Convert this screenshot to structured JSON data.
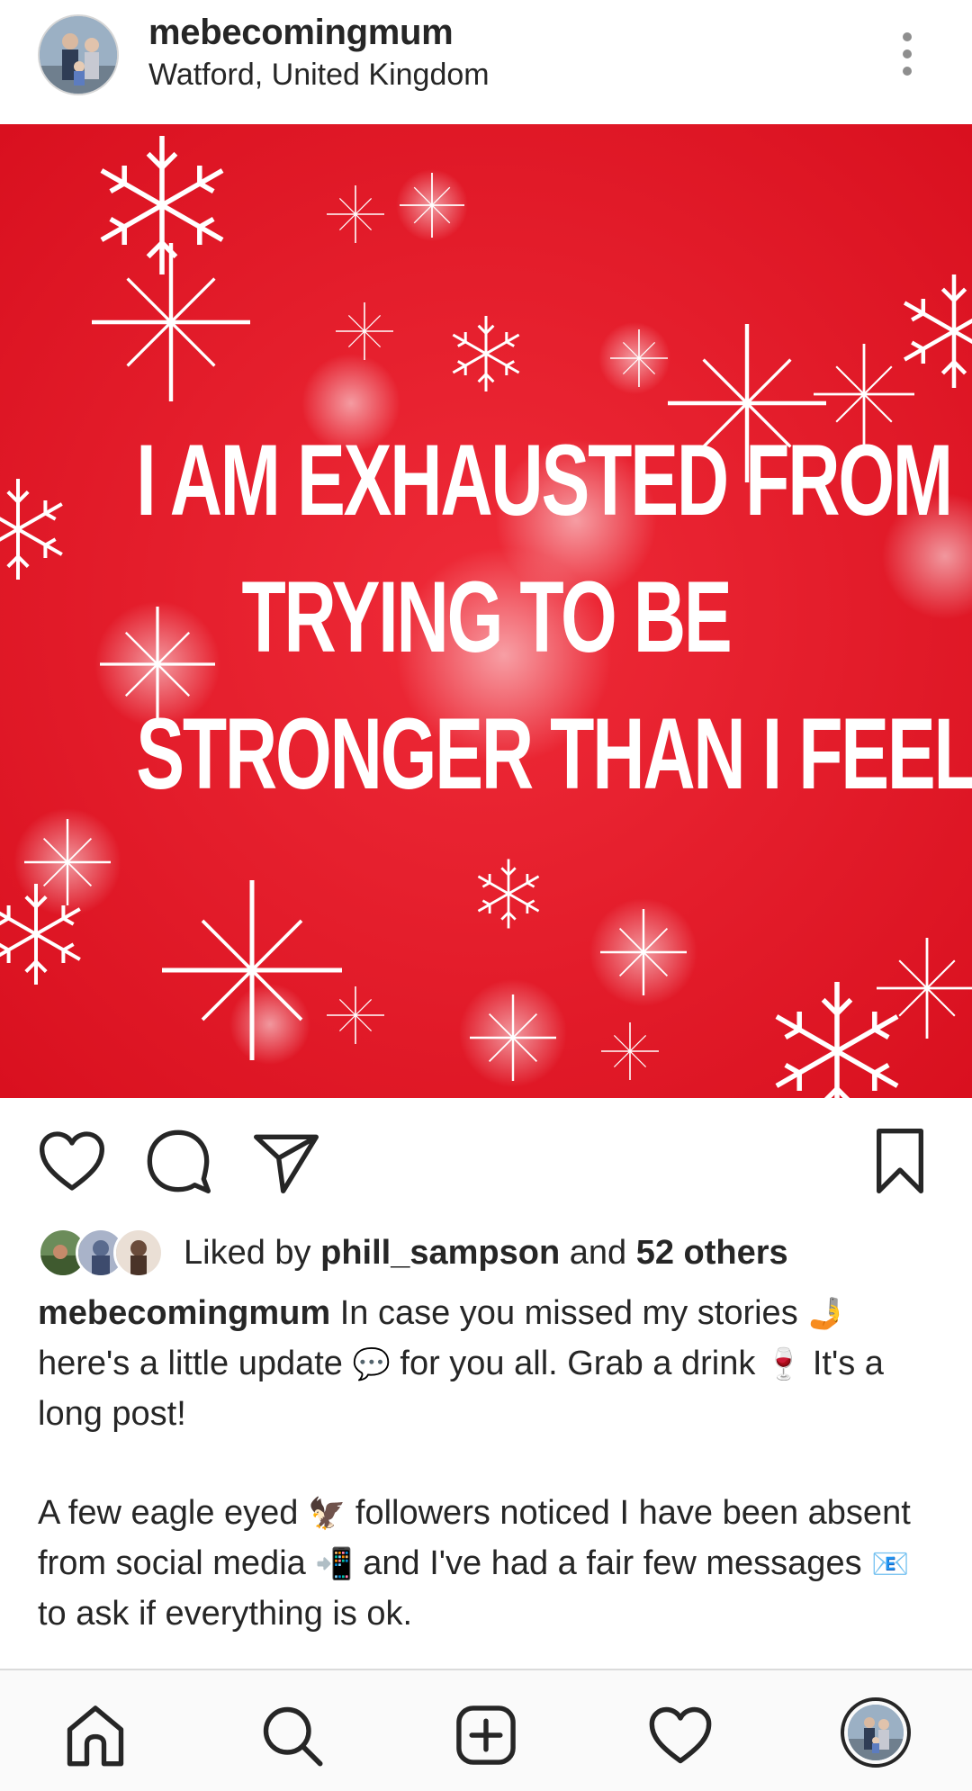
{
  "post": {
    "username": "mebecomingmum",
    "location": "Watford, United Kingdom",
    "image_text": [
      "I AM EXHAUSTED FROM",
      "TRYING TO BE",
      "STRONGER THAN I FEEL."
    ],
    "image_bg_color": "#e41c2b"
  },
  "actions": {
    "like_icon": "heart-outline-icon",
    "comment_icon": "comment-bubble-icon",
    "share_icon": "paper-plane-icon",
    "save_icon": "bookmark-icon"
  },
  "likes": {
    "prefix": "Liked by",
    "first_liker": "phill_sampson",
    "connector": "and",
    "others": "52 others"
  },
  "caption": {
    "username": "mebecomingmum",
    "line1_a": "In case you missed my stories",
    "emoji_selfie": "🤳",
    "line2_a": "here's a little update",
    "emoji_speech": "💬",
    "line2_b": "for you all. Grab a drink",
    "emoji_wine": "🍷",
    "line2_c": "It's a long post!",
    "para2_a": "A few eagle eyed",
    "emoji_eagle": "🦅",
    "para2_b": "followers noticed I have been absent from social media",
    "emoji_phone": "📲",
    "para2_c": "and I've had a fair few messages",
    "emoji_email": "📧",
    "para2_d": "to ask if everything is ok."
  },
  "nav": {
    "home_icon": "home-icon",
    "search_icon": "search-icon",
    "new_post_icon": "new-post-icon",
    "activity_icon": "heart-activity-icon",
    "profile_icon": "profile-avatar"
  }
}
